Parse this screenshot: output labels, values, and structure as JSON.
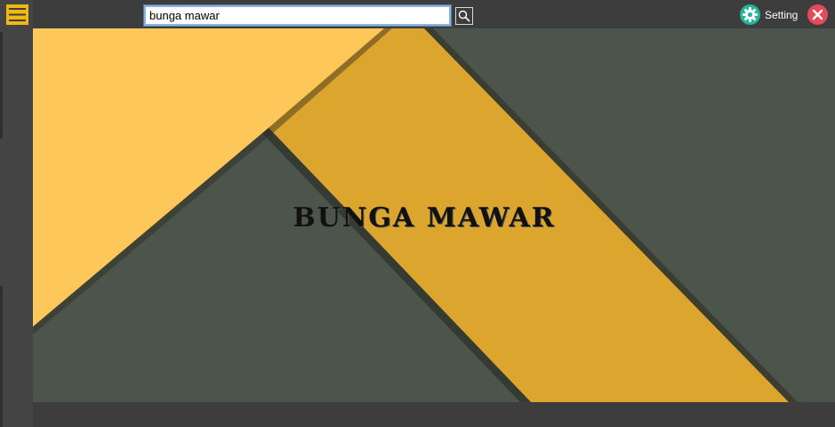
{
  "search": {
    "value": "bunga mawar"
  },
  "toolbar": {
    "setting_label": "Setting"
  },
  "main": {
    "headline": "BUNGA MAWAR"
  },
  "icons": {
    "menu": "hamburger-menu-icon",
    "search": "search-icon",
    "setting": "gear-icon",
    "close": "close-icon"
  },
  "colors": {
    "background": "#3d3d3d",
    "menu_accent": "#f1b814",
    "setting_accent": "#22b59a",
    "close_accent": "#e8495a",
    "banner_light_yellow": "#fec75a",
    "banner_dark_yellow": "#dca62e",
    "banner_grey_green": "#4b554b"
  }
}
